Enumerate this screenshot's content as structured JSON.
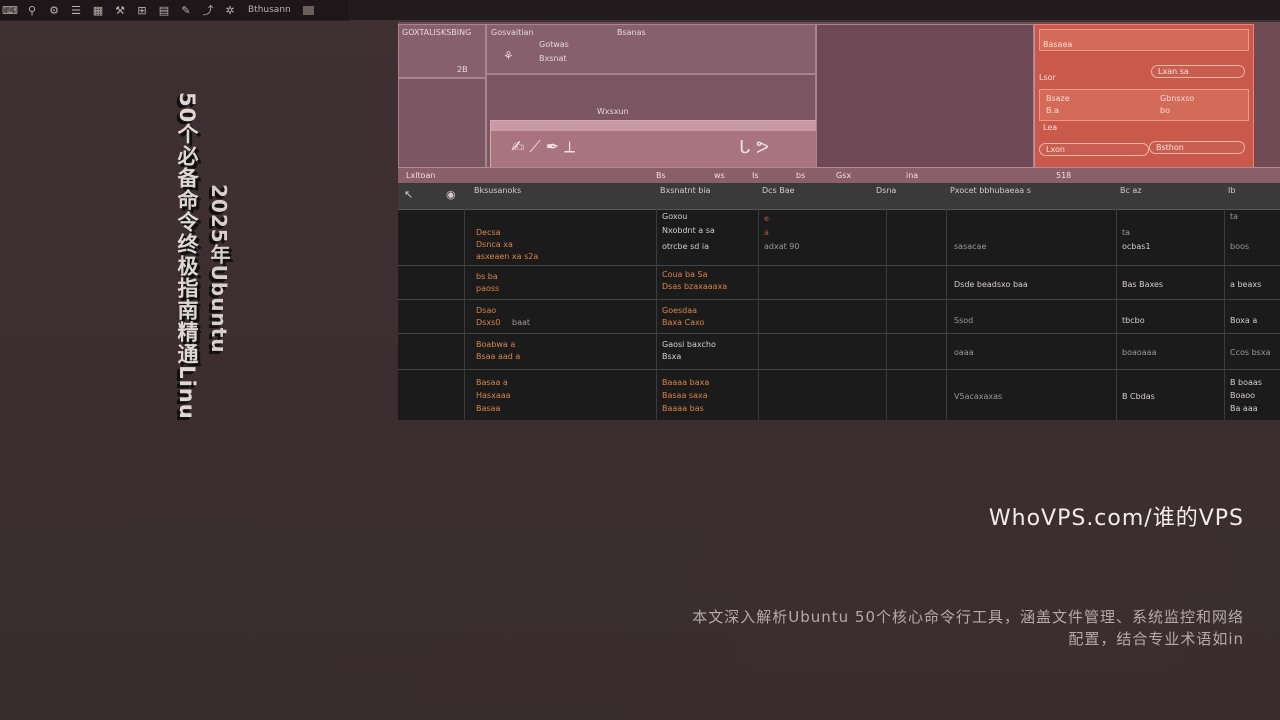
{
  "toolbar": {
    "icons": [
      "keyboard-icon",
      "pin-icon",
      "gear-icon",
      "list-icon",
      "grid-icon",
      "wrench-icon",
      "chart-icon",
      "doc-icon",
      "tool-icon",
      "share-icon",
      "settings-icon"
    ],
    "label": "Bthusann"
  },
  "titles": {
    "line1": "50个必备命令终极指南精通Linu",
    "line2": "2025年Ubuntu"
  },
  "app": {
    "panel_top_left": "GOXTALISKSBING",
    "panel_top_left_num": "2B",
    "panel_top_mid_a": "Gosvaitian",
    "panel_top_mid_b": "Bsanas",
    "panel_top_mid_c": "Gotwas",
    "panel_top_mid_d": "Bxsnat",
    "panel_mid": "Wxsxun",
    "orange_title": "Basaea",
    "orange_label": "Lsor",
    "orange_pill": "Lxan sa",
    "orange_r1a": "Bsaze",
    "orange_r1b": "Gbnsxso",
    "orange_r1c": "B.a",
    "orange_r1d": "bo",
    "orange_r2": "Lea",
    "orange_pill2": "Lxon",
    "orange_pill3": "Bsthon",
    "band": [
      "Lxltoan",
      "Bs",
      "ws",
      "Is",
      "bs",
      "Gsx",
      "ina",
      "518"
    ],
    "headers": [
      "Bksusanoks",
      "Bxsnatnt bia",
      "Dcs Bae",
      "Dsna",
      "Pxocet bbhubaeaa s",
      "Bc az",
      "Ib"
    ],
    "rows": [
      {
        "c1": [
          "Decsa",
          "Dsnca xa",
          "asxeaen xa s2a"
        ],
        "c2": [
          "Goxou",
          "Nxobdnt a sa",
          "otrcbe sd ia"
        ],
        "c3": [
          "e",
          "a",
          "adxat 90"
        ],
        "c5": "sasacae",
        "c6": [
          "ta",
          "ocbas1"
        ],
        "c7": [
          "ta",
          "boos"
        ]
      },
      {
        "c1": [
          "bs ba",
          "paoss"
        ],
        "c2": [
          "Coua ba Sa",
          "Dsas bzaxaaaxa"
        ],
        "c5": "Dsde beadsxo baa",
        "c6": "Bas Baxes",
        "c7": "a beaxs"
      },
      {
        "c1": [
          "Dsao",
          "Dsxs0",
          "baat"
        ],
        "c2": [
          "Goesdaa",
          "Baxa Caxo"
        ],
        "c5": "Ssod",
        "c6": "tbcbo",
        "c7": "Boxa a"
      },
      {
        "c1": [
          "Boabwa a",
          "Bsaa aad a"
        ],
        "c2": [
          "Gaosi baxcho",
          "Bsxa"
        ],
        "c5": "oaaa",
        "c6": "boaoaaa",
        "c7": "Ccos bsxa"
      },
      {
        "c1": [
          "Basaa a",
          "Hasxaaa",
          "Basaa"
        ],
        "c2": [
          "Baaaa baxa",
          "Basaa saxa",
          "Baaaa bas"
        ],
        "c5": "V5acaxaxas",
        "c6": "B Cbdas",
        "c7": [
          "B boaas",
          "Boaoo",
          "Ba aaa"
        ]
      }
    ]
  },
  "brand": "WhoVPS.com/谁的VPS",
  "description": "本文深入解析Ubuntu 50个核心命令行工具，涵盖文件管理、系统监控和网络配置，结合专业术语如in"
}
